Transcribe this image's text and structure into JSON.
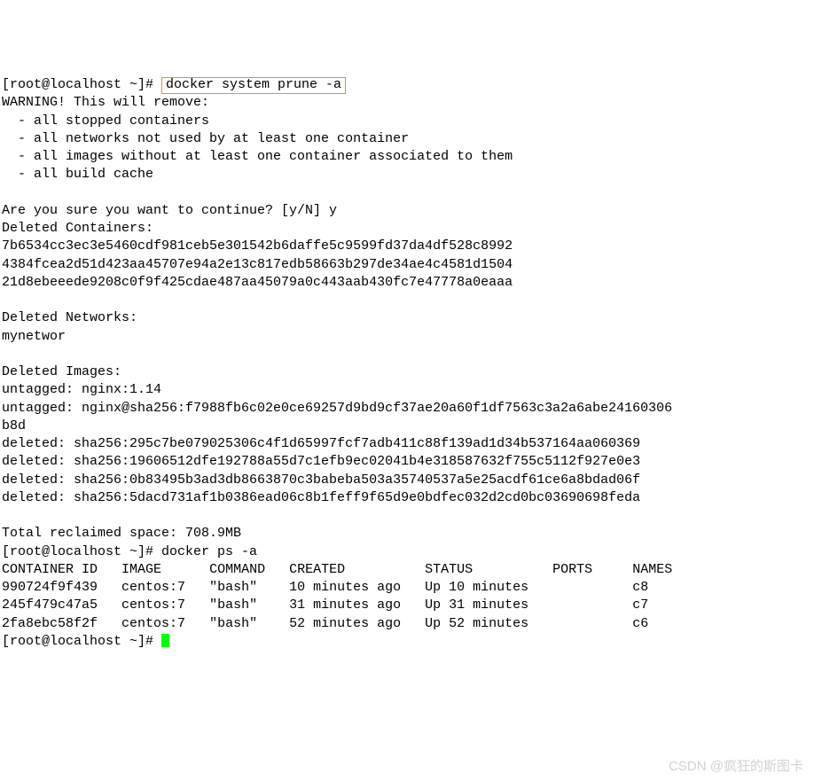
{
  "prompt1_prefix": "[root@localhost ~]# ",
  "highlighted_cmd": "docker system prune -a",
  "warning_header": "WARNING! This will remove:",
  "warning_items": [
    "  - all stopped containers",
    "  - all networks not used by at least one container",
    "  - all images without at least one container associated to them",
    "  - all build cache"
  ],
  "confirm_line": "Are you sure you want to continue? [y/N] y",
  "deleted_containers_header": "Deleted Containers:",
  "deleted_containers": [
    "7b6534cc3ec3e5460cdf981ceb5e301542b6daffe5c9599fd37da4df528c8992",
    "4384fcea2d51d423aa45707e94a2e13c817edb58663b297de34ae4c4581d1504",
    "21d8ebeeede9208c0f9f425cdae487aa45079a0c443aab430fc7e47778a0eaaa"
  ],
  "deleted_networks_header": "Deleted Networks:",
  "deleted_networks": [
    "mynetwor"
  ],
  "deleted_images_header": "Deleted Images:",
  "deleted_images": [
    "untagged: nginx:1.14",
    "untagged: nginx@sha256:f7988fb6c02e0ce69257d9bd9cf37ae20a60f1df7563c3a2a6abe24160306",
    "b8d",
    "deleted: sha256:295c7be079025306c4f1d65997fcf7adb411c88f139ad1d34b537164aa060369",
    "deleted: sha256:19606512dfe192788a55d7c1efb9ec02041b4e318587632f755c5112f927e0e3",
    "deleted: sha256:0b83495b3ad3db8663870c3babeba503a35740537a5e25acdf61ce6a8bdad06f",
    "deleted: sha256:5dacd731af1b0386ead06c8b1feff9f65d9e0bdfec032d2cd0bc03690698feda"
  ],
  "reclaimed_line": "Total reclaimed space: 708.9MB",
  "prompt2": "[root@localhost ~]# docker ps -a",
  "ps_header": {
    "id": "CONTAINER ID",
    "image": "IMAGE",
    "command": "COMMAND",
    "created": "CREATED",
    "status": "STATUS",
    "ports": "PORTS",
    "names": "NAMES"
  },
  "ps_rows": [
    {
      "id": "990724f9f439",
      "image": "centos:7",
      "command": "\"bash\"",
      "created": "10 minutes ago",
      "status": "Up 10 minutes",
      "ports": "",
      "names": "c8"
    },
    {
      "id": "245f479c47a5",
      "image": "centos:7",
      "command": "\"bash\"",
      "created": "31 minutes ago",
      "status": "Up 31 minutes",
      "ports": "",
      "names": "c7"
    },
    {
      "id": "2fa8ebc58f2f",
      "image": "centos:7",
      "command": "\"bash\"",
      "created": "52 minutes ago",
      "status": "Up 52 minutes",
      "ports": "",
      "names": "c6"
    }
  ],
  "prompt3": "[root@localhost ~]# ",
  "watermark": "CSDN @疯狂的斯图卡"
}
